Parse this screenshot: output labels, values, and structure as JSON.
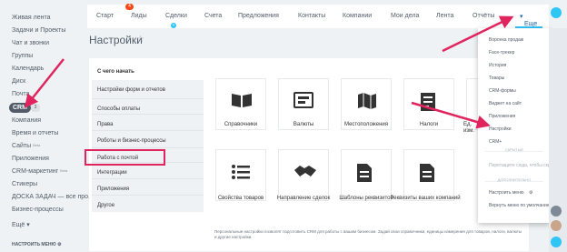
{
  "sidebar": {
    "items": [
      "Живая лента",
      "Задачи и Проекты",
      "Чат и звонки",
      "Группы",
      "Календарь",
      "Диск",
      "Почта"
    ],
    "crm_label": "CRM",
    "crm_count": "3",
    "items_after": [
      "Компания",
      "Время и отчеты",
      "Сайты",
      "Приложения",
      "CRM-маркетинг",
      "Стикеры",
      "ДОСКА ЗАДАЧ — все про...",
      "Бизнес-процессы",
      "Ещё"
    ],
    "beta": "Beta",
    "settings_label": "НАСТРОИТЬ МЕНЮ"
  },
  "topnav": {
    "items": [
      "Старт",
      "Лиды",
      "Сделки",
      "Счета",
      "Предложения",
      "Контакты",
      "Компании",
      "Мои дела",
      "Лента",
      "Отчёты"
    ],
    "deals_badge": "4",
    "plus": "+",
    "more_label": "Еще"
  },
  "page": {
    "title": "Настройки",
    "star": "☆"
  },
  "settings_menu": {
    "heading": "С чего начать",
    "items": [
      "Настройки форм и отчетов",
      "Способы оплаты",
      "Права",
      "Роботы и бизнес-процессы",
      "Работа с почтой",
      "Интеграции",
      "Приложения",
      "Другое"
    ]
  },
  "tiles": [
    {
      "label": "Справочники",
      "icon": "book-icon"
    },
    {
      "label": "Валюты",
      "icon": "currency-icon"
    },
    {
      "label": "Местоположения",
      "icon": "map-icon"
    },
    {
      "label": "Налоги",
      "icon": "tax-icon"
    },
    {
      "label": "Ед. изм.",
      "icon": "measure-icon"
    },
    {
      "label": "Свойства товаров",
      "icon": "list-icon"
    },
    {
      "label": "Направление сделок",
      "icon": "handshake-icon"
    },
    {
      "label": "Шаблоны реквизитов",
      "icon": "document-icon"
    },
    {
      "label": "Реквизиты ваших компаний",
      "icon": "document-icon"
    }
  ],
  "footnote": "Персональные настройки позволят подготовить CRM для работы с вашим бизнесом. Задай свои справочники, единицы измерения для товаров, налоги, валюты и другие настройки.",
  "dropdown": {
    "items": [
      "Воронка продаж",
      "Face-трекер",
      "История",
      "Товары",
      "CRM-формы",
      "Виджет на сайт",
      "Приложения",
      "Настройки",
      "CRM+"
    ],
    "hidden_sep": "СКРЫТЫЕ",
    "drag_hint": "Перетащите сюда, чтобы скрыть",
    "more_sep": "ДОПОЛНИТЕЛЬНО",
    "configure": "Настроить меню",
    "reset": "Вернуть меню по умолчанию"
  },
  "colors": {
    "accent": "#2fc6f6",
    "arrow": "#e0245e",
    "link": "#2067b0"
  }
}
